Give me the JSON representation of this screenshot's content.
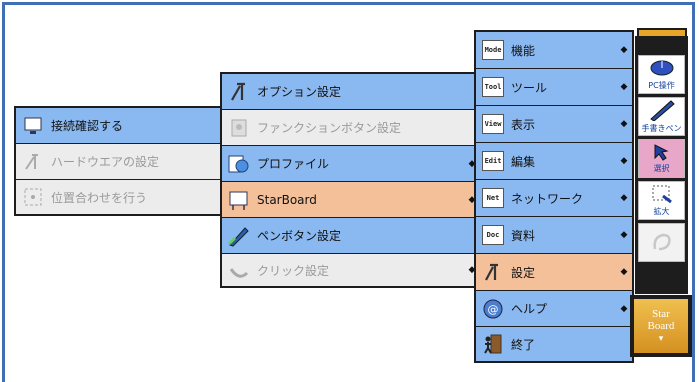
{
  "submenu_starboard": {
    "items": [
      {
        "label": "接続確認する",
        "state": "blue",
        "icon": "monitor-check-icon"
      },
      {
        "label": "ハードウエアの設定",
        "state": "gray",
        "icon": "tools-icon"
      },
      {
        "label": "位置合わせを行う",
        "state": "gray",
        "icon": "calibrate-icon"
      }
    ]
  },
  "submenu_settings": {
    "items": [
      {
        "label": "オプション設定",
        "state": "blue",
        "icon": "tools-icon",
        "arrow": ""
      },
      {
        "label": "ファンクションボタン設定",
        "state": "gray",
        "icon": "function-button-icon",
        "arrow": ""
      },
      {
        "label": "プロファイル",
        "state": "blue",
        "icon": "profile-icon",
        "arrow": "◆"
      },
      {
        "label": "StarBoard",
        "state": "orange",
        "icon": "board-icon",
        "arrow": "◆"
      },
      {
        "label": "ペンボタン設定",
        "state": "blue",
        "icon": "pen-icon",
        "arrow": ""
      },
      {
        "label": "クリック設定",
        "state": "gray",
        "icon": "click-icon",
        "arrow": "◆"
      }
    ]
  },
  "main_menu": {
    "items": [
      {
        "label": "機能",
        "code": "Mode",
        "state": "blue",
        "icon": "mode-icon",
        "arrow": "◆"
      },
      {
        "label": "ツール",
        "code": "Tool",
        "state": "blue",
        "icon": "tool-icon",
        "arrow": "◆"
      },
      {
        "label": "表示",
        "code": "View",
        "state": "blue",
        "icon": "view-icon",
        "arrow": "◆"
      },
      {
        "label": "編集",
        "code": "Edit",
        "state": "blue",
        "icon": "edit-icon",
        "arrow": "◆"
      },
      {
        "label": "ネットワーク",
        "code": "Net",
        "state": "blue",
        "icon": "network-icon",
        "arrow": "◆"
      },
      {
        "label": "資料",
        "code": "Doc",
        "state": "blue",
        "icon": "document-icon",
        "arrow": "◆"
      },
      {
        "label": "設定",
        "code": "",
        "state": "orange",
        "icon": "settings-icon",
        "arrow": "◆"
      },
      {
        "label": "ヘルプ",
        "code": "",
        "state": "blue",
        "icon": "help-icon",
        "arrow": "◆"
      },
      {
        "label": "終了",
        "code": "",
        "state": "blue",
        "icon": "exit-icon",
        "arrow": ""
      }
    ]
  },
  "palette": {
    "top_button_icon": "dropdown-arrow-icon",
    "buttons": [
      {
        "label": "PC操作",
        "icon": "mouse-icon",
        "state": "white"
      },
      {
        "label": "手書きペン",
        "icon": "pen-icon",
        "state": "white"
      },
      {
        "label": "選択",
        "icon": "select-arrow-icon",
        "state": "pink"
      },
      {
        "label": "拡大",
        "icon": "zoom-icon",
        "state": "white"
      },
      {
        "label": "",
        "icon": "disabled-tool-icon",
        "state": "dim"
      }
    ],
    "starboard_button": {
      "line1": "Star",
      "line2": "Board"
    }
  },
  "colors": {
    "blue": "#8ab8f0",
    "orange": "#f4c09a",
    "gray": "#ececec",
    "frame": "#3f6fb5"
  }
}
